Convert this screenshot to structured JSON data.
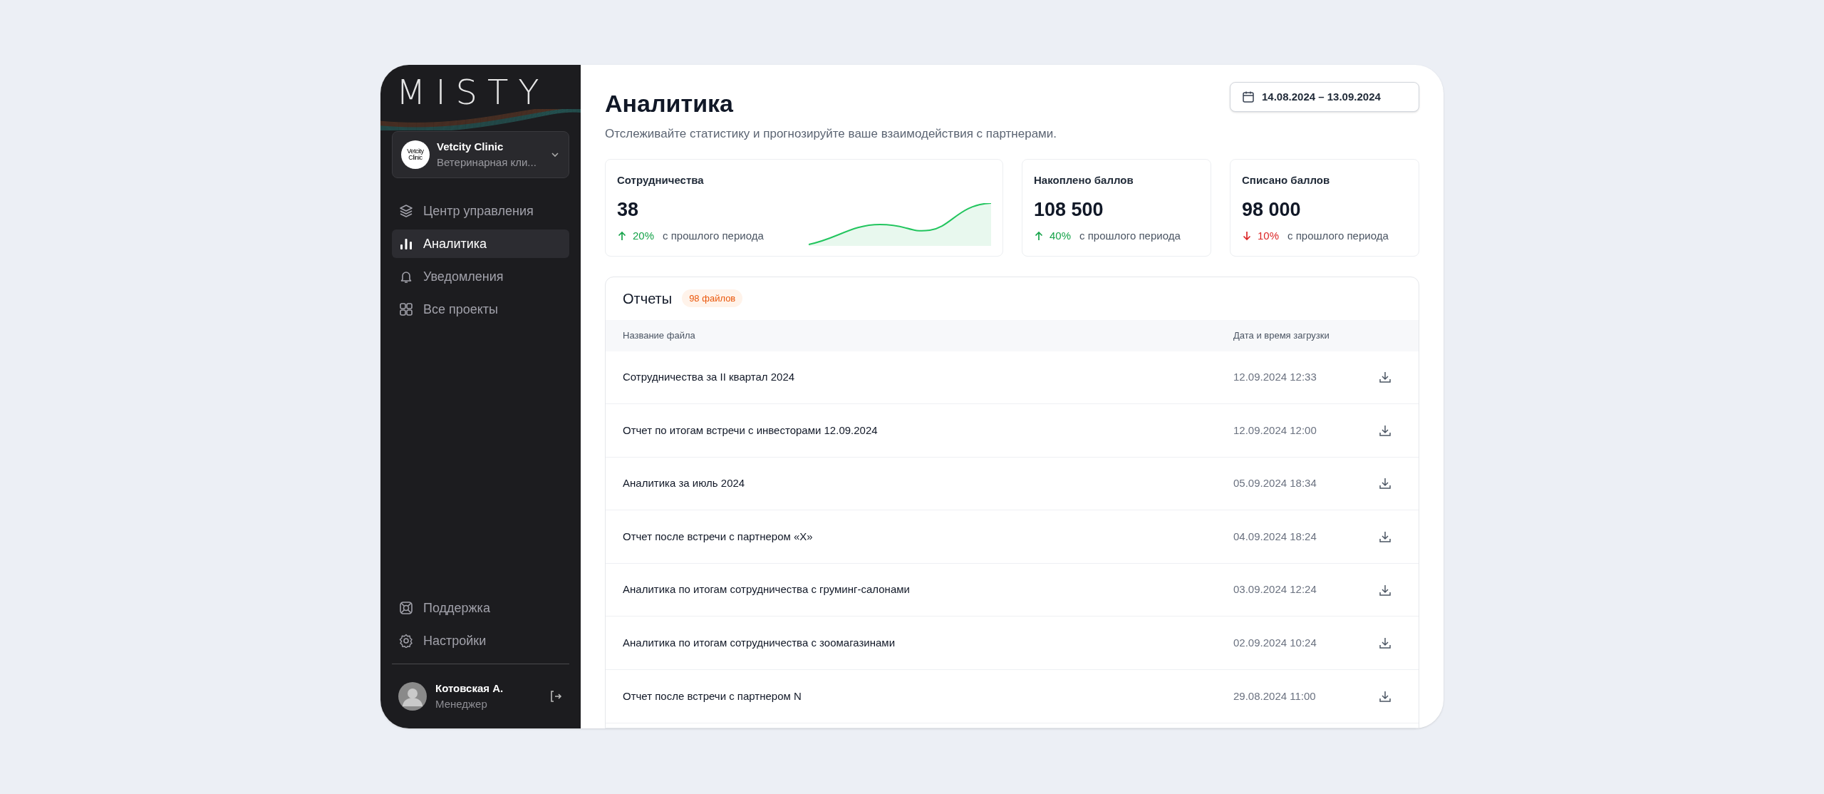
{
  "logo": "MISTY",
  "org": {
    "logo_text": "Vetcity Clinic",
    "name": "Vetcity Clinic",
    "subtitle": "Ветеринарная кли..."
  },
  "nav": [
    {
      "label": "Центр управления",
      "selected": false
    },
    {
      "label": "Аналитика",
      "selected": true
    },
    {
      "label": "Уведомления",
      "selected": false
    },
    {
      "label": "Все проекты",
      "selected": false
    }
  ],
  "footer_nav": [
    {
      "label": "Поддержка"
    },
    {
      "label": "Настройки"
    }
  ],
  "user": {
    "name": "Котовская А.",
    "role": "Менеджер"
  },
  "header": {
    "title": "Аналитика",
    "subtitle": "Отслеживайте статистику и прогнозируйте ваше взаимодействия с партнерами.",
    "date_range": "14.08.2024 – 13.09.2024"
  },
  "stats": [
    {
      "label": "Сотрудничества",
      "value": "38",
      "kind": "up",
      "change": "20%",
      "note": "с прошлого периода",
      "sparkline": true
    },
    {
      "label": "Накоплено баллов",
      "value": "108 500",
      "kind": "up",
      "change": "40%",
      "note": "с прошлого периода",
      "sparkline": false
    },
    {
      "label": "Списано баллов",
      "value": "98 000",
      "kind": "down",
      "change": "10%",
      "note": "с прошлого периода",
      "sparkline": false
    }
  ],
  "reports": {
    "title": "Отчеты",
    "badge": "98 файлов",
    "columns": [
      "Название файла",
      "Дата и время загрузки"
    ],
    "rows": [
      {
        "name": "Сотрудничества за II квартал 2024",
        "date": "12.09.2024 12:33"
      },
      {
        "name": "Отчет по итогам встречи с инвесторами 12.09.2024",
        "date": "12.09.2024 12:00"
      },
      {
        "name": "Аналитика за июль 2024",
        "date": "05.09.2024 18:34"
      },
      {
        "name": "Отчет после встречи с партнером «X»",
        "date": "04.09.2024 18:24"
      },
      {
        "name": "Аналитика по итогам сотрудничества с груминг-салонами",
        "date": "03.09.2024 12:24"
      },
      {
        "name": "Аналитика по итогам сотрудничества с зоомагазинами",
        "date": "02.09.2024 10:24"
      },
      {
        "name": "Отчет после встречи с партнером N",
        "date": "29.08.2024 11:00"
      }
    ]
  }
}
